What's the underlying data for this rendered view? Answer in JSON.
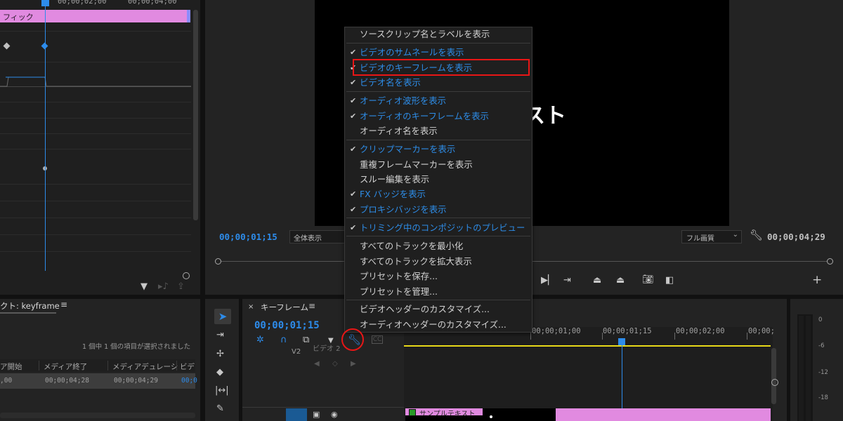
{
  "effect_controls": {
    "ruler_labels": [
      "00;00;02;00",
      "00;00;04;00"
    ],
    "clip_label": "フィック"
  },
  "program_monitor": {
    "preview_text": "スト",
    "current_timecode": "00;00;01;15",
    "zoom_select": "全体表示",
    "quality_select": "フル画質",
    "duration_timecode": "00;00;04;29"
  },
  "project_panel": {
    "tab_title": "クト: keyframe",
    "selection_status": "1 個中 1 個の項目が選択されました",
    "columns": [
      "ア開始",
      "メディア終了",
      "メディアデュレーシ",
      "ビデ"
    ],
    "row": {
      "start": ",00",
      "end": "00;00;04;28",
      "duration": "00;00;04;29",
      "video": "00;0"
    }
  },
  "timeline": {
    "tab_label": "キーフレーム",
    "timecode": "00;00;01;15",
    "ruler_labels": [
      "00;00;01;00",
      "00;00;01;15",
      "00;00;02;00",
      "00;00;"
    ],
    "track_v2": "V2",
    "track_v2_name": "ビデオ 2",
    "clip_name": "サンプルテキスト"
  },
  "audio_meter": {
    "labels": [
      "0",
      "-6",
      "-12",
      "-18"
    ]
  },
  "context_menu": {
    "items": [
      {
        "label": "ソースクリップ名とラベルを表示",
        "checked": false
      },
      {
        "label": "ビデオのサムネールを表示",
        "checked": true
      },
      {
        "label": "ビデオのキーフレームを表示",
        "checked": true
      },
      {
        "label": "ビデオ名を表示",
        "checked": true
      },
      {
        "label": "オーディオ波形を表示",
        "checked": true
      },
      {
        "label": "オーディオのキーフレームを表示",
        "checked": true
      },
      {
        "label": "オーディオ名を表示",
        "checked": false
      },
      {
        "label": "クリップマーカーを表示",
        "checked": true
      },
      {
        "label": "重複フレームマーカーを表示",
        "checked": false
      },
      {
        "label": "スルー編集を表示",
        "checked": false
      },
      {
        "label": "FX バッジを表示",
        "checked": true
      },
      {
        "label": "プロキシバッジを表示",
        "checked": true
      },
      {
        "label": "トリミング中のコンポジットのプレビュー",
        "checked": true
      },
      {
        "label": "すべてのトラックを最小化",
        "checked": false
      },
      {
        "label": "すべてのトラックを拡大表示",
        "checked": false
      },
      {
        "label": "プリセットを保存...",
        "checked": false
      },
      {
        "label": "プリセットを管理...",
        "checked": false
      },
      {
        "label": "ビデオヘッダーのカスタマイズ...",
        "checked": false
      },
      {
        "label": "オーディオヘッダーのカスタマイズ...",
        "checked": false
      }
    ]
  },
  "colors": {
    "accent_blue": "#2d8ceb",
    "clip_pink": "#e18ae0",
    "highlight_red": "#e81616",
    "work_area_yellow": "#e8d818"
  },
  "icons": {
    "checkmark": "check-icon",
    "wrench": "wrench-icon",
    "selection": "selection-tool-icon"
  }
}
